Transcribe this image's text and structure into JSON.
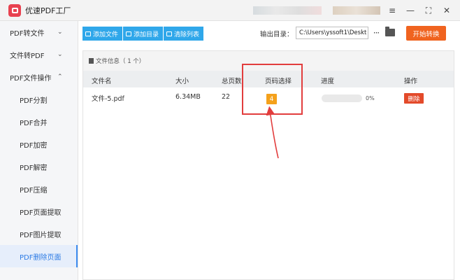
{
  "app": {
    "title": "优速PDF工厂"
  },
  "window_controls": {
    "menu_icon": "hamburger-icon",
    "minimize_icon": "minimize-icon",
    "restore_icon": "restore-icon",
    "close_icon": "close-icon"
  },
  "sidebar": {
    "items": [
      {
        "label": "PDF转文件",
        "chevron": "⌄"
      },
      {
        "label": "文件转PDF",
        "chevron": "⌄"
      },
      {
        "label": "PDF文件操作",
        "chevron": "⌃"
      },
      {
        "label": "PDF分割"
      },
      {
        "label": "PDF合并"
      },
      {
        "label": "PDF加密"
      },
      {
        "label": "PDF解密"
      },
      {
        "label": "PDF压缩"
      },
      {
        "label": "PDF页面提取"
      },
      {
        "label": "PDF图片提取"
      },
      {
        "label": "PDF删除页面"
      }
    ],
    "active_index": 10
  },
  "toolbar": {
    "add_file": "添加文件",
    "add_folder": "添加目录",
    "clear_list": "清除列表",
    "output_label": "输出目录：",
    "output_path": "C:\\Users\\yssoft1\\Deskt",
    "more": "···",
    "start": "开始转换"
  },
  "panel": {
    "title": "文件信息（ 1 个）",
    "columns": [
      "文件名",
      "大小",
      "总页数",
      "页码选择",
      "进度",
      "操作"
    ],
    "rows": [
      {
        "filename": "文件-5.pdf",
        "size": "6.34MB",
        "pages": "22",
        "page_select": "4",
        "progress": 0,
        "progress_text": "0%",
        "action": "删除"
      }
    ]
  },
  "colors": {
    "accent_blue": "#2fa7ea",
    "start_orange": "#f0631f",
    "badge_orange": "#f4a11b",
    "delete_red": "#e34a2a",
    "annotation_red": "#e23d3d"
  }
}
